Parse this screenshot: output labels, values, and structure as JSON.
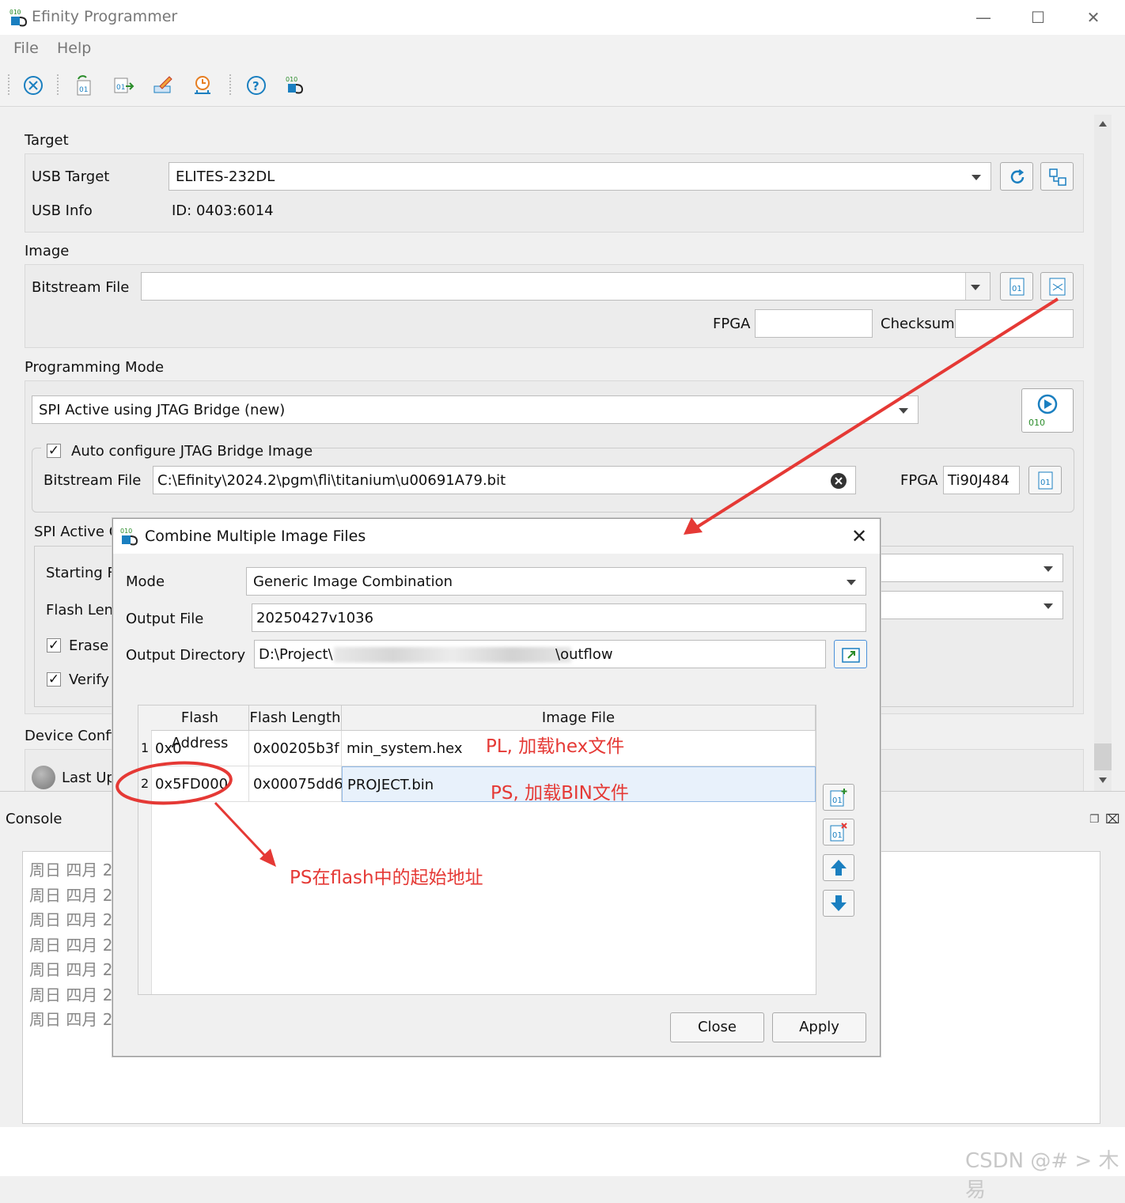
{
  "window": {
    "title": "Efinity Programmer"
  },
  "menu": {
    "file": "File",
    "help": "Help"
  },
  "target": {
    "section": "Target",
    "usb_target_label": "USB Target",
    "usb_target_value": "ELITES-232DL",
    "usb_info_label": "USB Info",
    "usb_info_value": "ID: 0403:6014"
  },
  "image": {
    "section": "Image",
    "bitstream_label": "Bitstream File",
    "bitstream_value": "",
    "fpga_label": "FPGA",
    "checksum_label": "Checksum"
  },
  "programming": {
    "section": "Programming Mode",
    "mode_value": "SPI Active using JTAG Bridge (new)",
    "start_icon_text": "010",
    "auto_config_label": "Auto configure JTAG Bridge Image",
    "bridge_bitstream_label": "Bitstream File",
    "bridge_bitstream_value": "C:\\Efinity\\2024.2\\pgm\\fli\\titanium\\u00691A79.bit",
    "bridge_fpga_label": "FPGA",
    "bridge_fpga_value": "Ti90J484",
    "spi_active_label": "SPI Active O",
    "starting_flash_label": "Starting Fl",
    "flash_length_label": "Flash Leng",
    "erase_label": "Erase E",
    "verify_label": "Verify A"
  },
  "device_config": {
    "section": "Device Config",
    "last_update": "Last Up"
  },
  "console": {
    "title": "Console",
    "lines": [
      "周日 四月 2",
      "周日 四月 2",
      "周日 四月 2",
      "周日 四月 2",
      "周日 四月 2",
      "周日 四月 2",
      "周日 四月 2"
    ]
  },
  "dialog": {
    "title": "Combine Multiple Image Files",
    "mode_label": "Mode",
    "mode_value": "Generic Image Combination",
    "output_file_label": "Output File",
    "output_file_value": "20250427v1036",
    "output_dir_label": "Output Directory",
    "output_dir_start": "D:\\Project\\",
    "output_dir_end": "\\outflow",
    "columns": [
      "Flash Address",
      "Flash Length",
      "Image File"
    ],
    "rows": [
      {
        "num": "1",
        "address": "0x0",
        "length": "0x00205b3f",
        "file": "min_system.hex"
      },
      {
        "num": "2",
        "address": "0x5FD000",
        "length": "0x00075dd6",
        "file": "PROJECT.bin"
      }
    ],
    "close_label": "Close",
    "apply_label": "Apply"
  },
  "annotations": {
    "pl": "PL, 加载hex文件",
    "ps": "PS, 加载BIN文件",
    "ps_addr": "PS在flash中的起始地址"
  },
  "watermark": "CSDN @# > 木易"
}
